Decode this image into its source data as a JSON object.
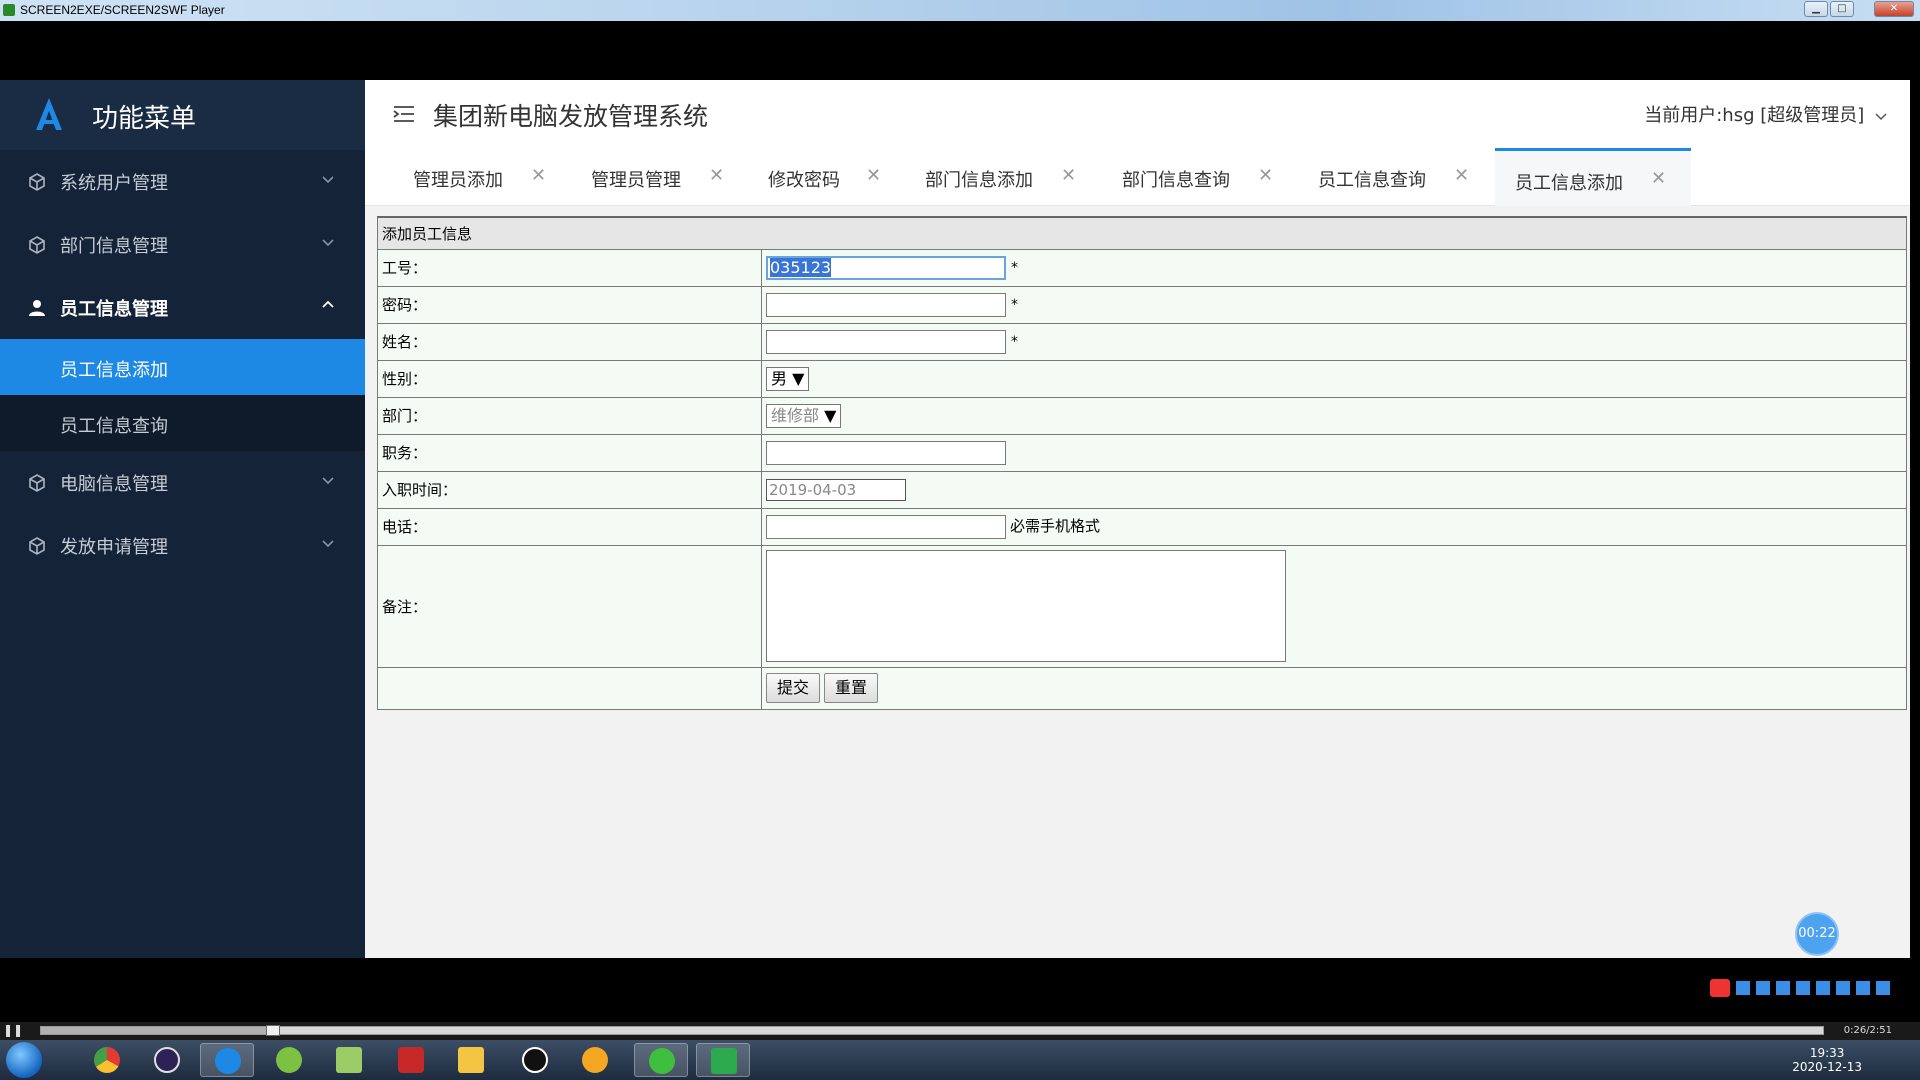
{
  "player": {
    "title": "SCREEN2EXE/SCREEN2SWF Player",
    "time_readout": "0:26/2:51",
    "progress_fraction": 0.13,
    "minimize": "▁",
    "maximize": "□",
    "close": "✕"
  },
  "sidebar": {
    "brand": "功能菜单",
    "items": [
      {
        "label": "系统用户管理",
        "icon": "cube-icon",
        "expanded": false
      },
      {
        "label": "部门信息管理",
        "icon": "cube-icon",
        "expanded": false
      },
      {
        "label": "员工信息管理",
        "icon": "user-icon",
        "expanded": true,
        "children": [
          {
            "label": "员工信息添加",
            "active": true
          },
          {
            "label": "员工信息查询",
            "active": false
          }
        ]
      },
      {
        "label": "电脑信息管理",
        "icon": "cube-icon",
        "expanded": false
      },
      {
        "label": "发放申请管理",
        "icon": "cube-icon",
        "expanded": false
      }
    ]
  },
  "header": {
    "system_title": "集团新电脑发放管理系统",
    "current_user": "当前用户:hsg [超级管理员]"
  },
  "tabs": [
    {
      "label": "管理员添加",
      "active": false
    },
    {
      "label": "管理员管理",
      "active": false
    },
    {
      "label": "修改密码",
      "active": false
    },
    {
      "label": "部门信息添加",
      "active": false
    },
    {
      "label": "部门信息查询",
      "active": false
    },
    {
      "label": "员工信息查询",
      "active": false
    },
    {
      "label": "员工信息添加",
      "active": true
    }
  ],
  "form": {
    "heading": "添加员工信息",
    "fields": {
      "emp_no": {
        "label": "工号：",
        "value": "035123",
        "required": "*"
      },
      "password": {
        "label": "密码：",
        "value": "",
        "required": "*"
      },
      "name": {
        "label": "姓名：",
        "value": "",
        "required": "*"
      },
      "gender": {
        "label": "性别：",
        "selected": "男"
      },
      "department": {
        "label": "部门：",
        "selected": "维修部"
      },
      "position": {
        "label": "职务：",
        "value": ""
      },
      "hire_date": {
        "label": "入职时间：",
        "value": "2019-04-03"
      },
      "phone": {
        "label": "电话：",
        "value": "",
        "hint": "必需手机格式"
      },
      "remark": {
        "label": "备注：",
        "value": ""
      }
    },
    "submit_label": "提交",
    "reset_label": "重置"
  },
  "timer_badge": "00:22",
  "taskbar": {
    "clock_time": "19:33",
    "clock_date": "2020-12-13"
  },
  "colors": {
    "sidebar_bg": "#152338",
    "accent": "#1e88e5",
    "form_bg": "#f4fbf4"
  }
}
